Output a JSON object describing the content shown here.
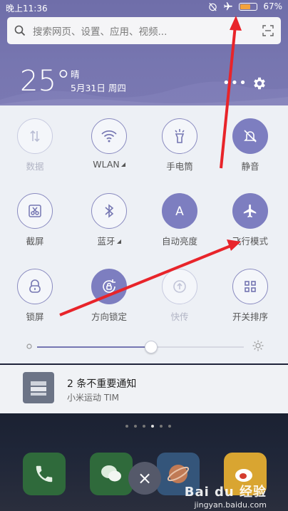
{
  "status_bar": {
    "time": "晚上11:36",
    "battery": "67%",
    "battery_level": 0.67
  },
  "search": {
    "placeholder": "搜索网页、设置、应用、视频..."
  },
  "weather": {
    "temperature": "25°",
    "condition": "晴",
    "date": "5月31日 周四"
  },
  "top_actions": {
    "more": "•••"
  },
  "tiles": [
    {
      "label": "数据",
      "icon": "data-icon",
      "state": "off"
    },
    {
      "label": "WLAN",
      "icon": "wifi-icon",
      "state": "normal",
      "expand": true
    },
    {
      "label": "手电筒",
      "icon": "flashlight-icon",
      "state": "normal"
    },
    {
      "label": "静音",
      "icon": "silent-bell-icon",
      "state": "on"
    },
    {
      "label": "截屏",
      "icon": "screenshot-scissors-icon",
      "state": "normal"
    },
    {
      "label": "蓝牙",
      "icon": "bluetooth-icon",
      "state": "normal",
      "expand": true
    },
    {
      "label": "自动亮度",
      "icon": "auto-brightness-icon",
      "state": "on"
    },
    {
      "label": "飞行模式",
      "icon": "airplane-icon",
      "state": "on"
    },
    {
      "label": "锁屏",
      "icon": "lock-icon",
      "state": "normal"
    },
    {
      "label": "方向锁定",
      "icon": "rotation-lock-icon",
      "state": "on"
    },
    {
      "label": "快传",
      "icon": "quick-transfer-icon",
      "state": "off"
    },
    {
      "label": "开关排序",
      "icon": "grid-icon",
      "state": "normal"
    }
  ],
  "brightness": {
    "level": 0.55
  },
  "notification": {
    "title": "2 条不重要通知",
    "subtitle": "小米运动 TIM"
  },
  "dock": {
    "close_label": "×"
  },
  "watermark": {
    "line1": "Bai du 经验",
    "line2": "jingyan.baidu.com"
  },
  "colors": {
    "accent": "#7d7ec0",
    "arrow": "#e8242a",
    "battery": "#f3a23c"
  }
}
